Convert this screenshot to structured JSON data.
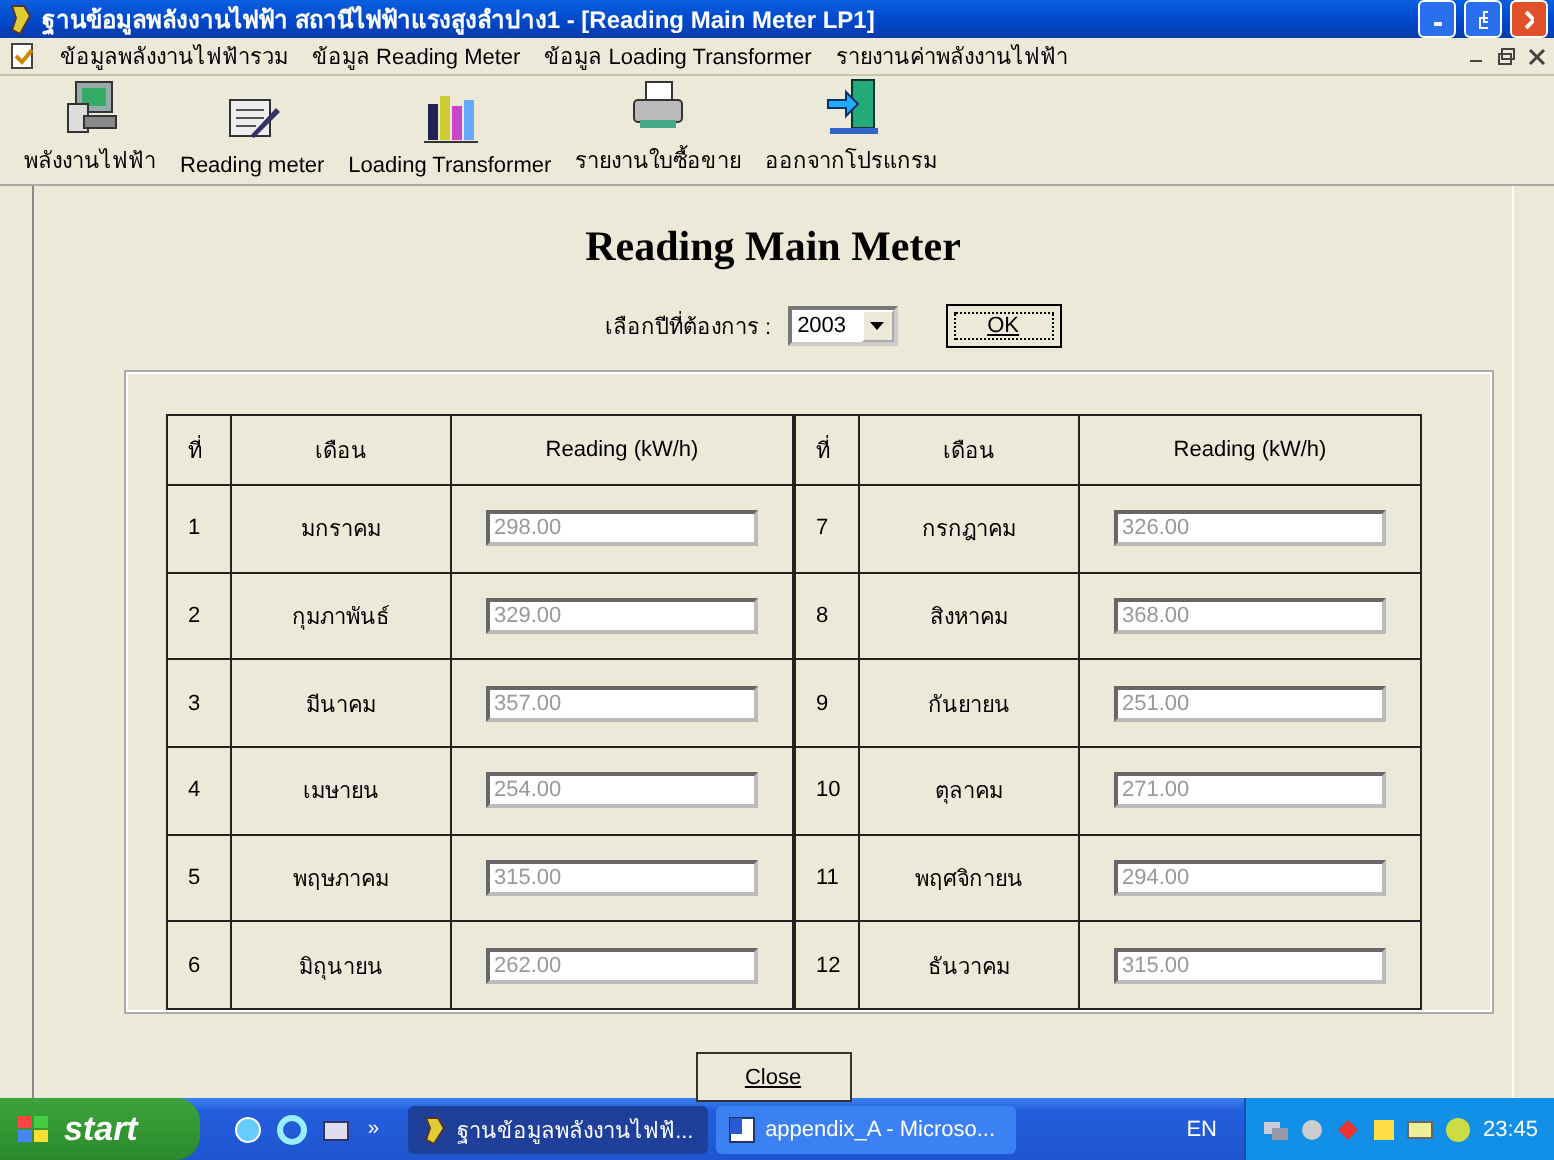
{
  "window": {
    "title": "ฐานข้อมูลพลังงานไฟฟ้า สถานีไฟฟ้าแรงสูงลำปาง1 - [Reading Main Meter LP1]"
  },
  "menu": [
    "ข้อมูลพลังงานไฟฟ้ารวม",
    "ข้อมูล Reading Meter",
    "ข้อมูล Loading Transformer",
    "รายงานค่าพลังงานไฟฟ้า"
  ],
  "toolbar": [
    {
      "label": "พลังงานไฟฟ้า",
      "kind": "computer"
    },
    {
      "label": "Reading meter",
      "kind": "scroll"
    },
    {
      "label": "Loading Transformer",
      "kind": "chart"
    },
    {
      "label": "รายงานใบซื้อขาย",
      "kind": "printer"
    },
    {
      "label": "ออกจากโปรแกรม",
      "kind": "exit"
    }
  ],
  "heading": "Reading Main Meter",
  "year_picker": {
    "label": "เลือกปีที่ต้องการ :",
    "value": "2003"
  },
  "ok_button": "OK",
  "tables": [
    {
      "columns": [
        "ที่",
        "เดือน",
        "Reading (kW/h)"
      ],
      "rows": [
        {
          "no": "1",
          "month": "มกราคม",
          "reading": "298.00",
          "disabled": true
        },
        {
          "no": "2",
          "month": "กุมภาพันธ์",
          "reading": "329.00",
          "disabled": true
        },
        {
          "no": "3",
          "month": "มีนาคม",
          "reading": "357.00",
          "disabled": true
        },
        {
          "no": "4",
          "month": "เมษายน",
          "reading": "254.00",
          "disabled": true
        },
        {
          "no": "5",
          "month": "พฤษภาคม",
          "reading": "315.00",
          "disabled": true
        },
        {
          "no": "6",
          "month": "มิถุนายน",
          "reading": "262.00",
          "disabled": true
        }
      ]
    },
    {
      "columns": [
        "ที่",
        "เดือน",
        "Reading (kW/h)"
      ],
      "rows": [
        {
          "no": "7",
          "month": "กรกฎาคม",
          "reading": "326.00",
          "disabled": true
        },
        {
          "no": "8",
          "month": "สิงหาคม",
          "reading": "368.00",
          "disabled": true
        },
        {
          "no": "9",
          "month": "กันยายน",
          "reading": "251.00",
          "disabled": true
        },
        {
          "no": "10",
          "month": "ตุลาคม",
          "reading": "271.00",
          "disabled": true
        },
        {
          "no": "11",
          "month": "พฤศจิกายน",
          "reading": "294.00",
          "disabled": true
        },
        {
          "no": "12",
          "month": "ธันวาคม",
          "reading": "315.00",
          "disabled": true
        }
      ]
    }
  ],
  "close_button": "Close",
  "taskbar": {
    "start": "start",
    "overflow": "»",
    "tasks": [
      {
        "label": "ฐานข้อมูลพลังงานไฟฟ้...",
        "selected": true
      },
      {
        "label": "appendix_A - Microso...",
        "selected": false
      }
    ],
    "language": "EN",
    "clock": "23:45"
  }
}
